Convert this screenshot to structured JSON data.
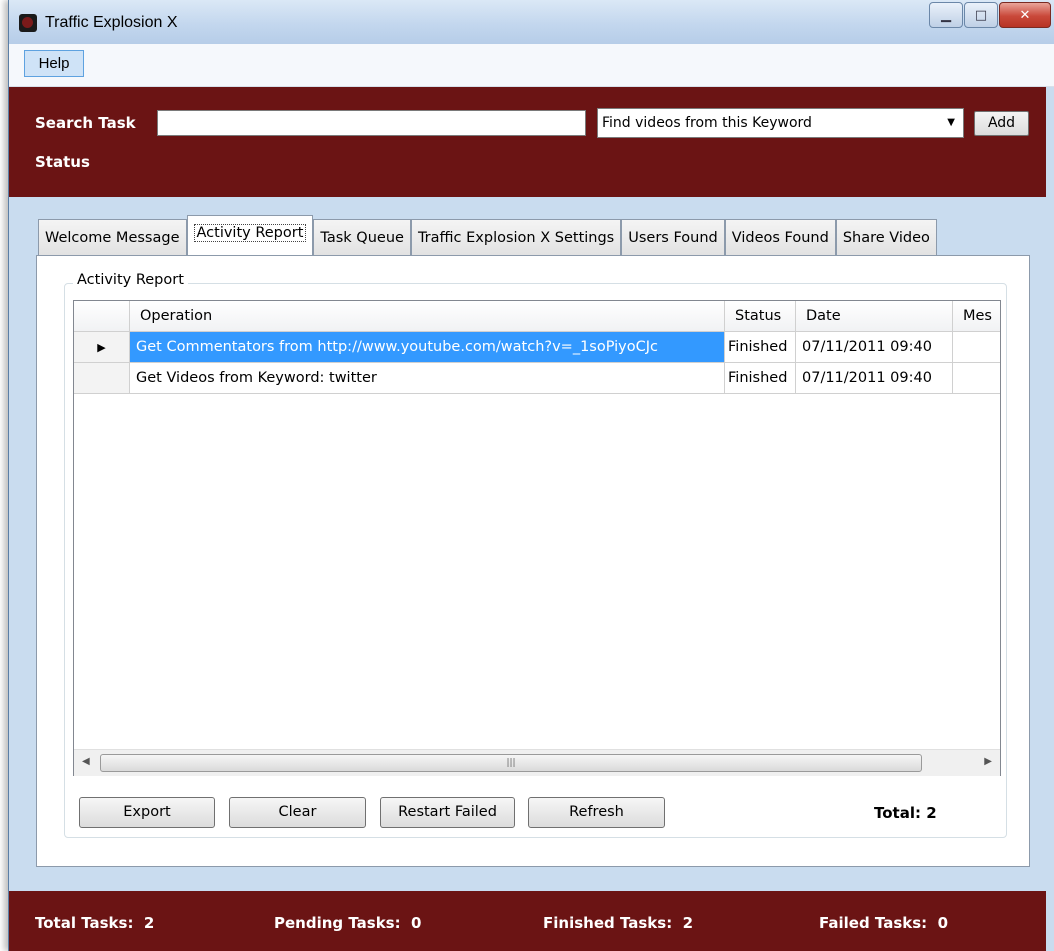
{
  "window": {
    "title": "Traffic Explosion X"
  },
  "menu": {
    "help": "Help"
  },
  "header": {
    "search_label": "Search Task",
    "search_value": "",
    "task_type": "Find videos from this Keyword",
    "add_label": "Add",
    "status_label": "Status"
  },
  "tabs": [
    {
      "label": "Welcome Message"
    },
    {
      "label": "Activity Report",
      "active": true
    },
    {
      "label": "Task Queue"
    },
    {
      "label": "Traffic Explosion X Settings"
    },
    {
      "label": "Users Found"
    },
    {
      "label": "Videos Found"
    },
    {
      "label": "Share Video"
    }
  ],
  "activity": {
    "group_title": "Activity Report",
    "columns": [
      "Operation",
      "Status",
      "Date",
      "Mes"
    ],
    "rows": [
      {
        "operation": "Get Commentators from http://www.youtube.com/watch?v=_1soPiyoCJc",
        "status": "Finished",
        "date": "07/11/2011 09:40",
        "message": "",
        "selected": true
      },
      {
        "operation": "Get Videos from Keyword: twitter",
        "status": "Finished",
        "date": "07/11/2011 09:40",
        "message": "",
        "selected": false
      }
    ],
    "buttons": {
      "export": "Export",
      "clear": "Clear",
      "restart_failed": "Restart Failed",
      "refresh": "Refresh"
    },
    "total": "Total: 2"
  },
  "footer": {
    "total_tasks": "Total Tasks:  2",
    "pending_tasks": "Pending Tasks:  0",
    "finished_tasks": "Finished Tasks:  2",
    "failed_tasks": "Failed Tasks:  0"
  },
  "colors": {
    "brand_red": "#6b1414",
    "selection_blue": "#3399ff"
  }
}
